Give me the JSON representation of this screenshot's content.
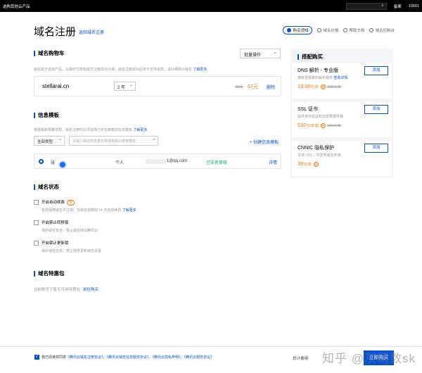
{
  "topbar": {
    "products": "选购其他云产品",
    "search_icon": "⌕",
    "lang": "备案",
    "account": "10001"
  },
  "header": {
    "title": "域名注册",
    "back_link": "返回域名注册",
    "links": [
      "购买须知",
      "域名价格",
      "帮助文档",
      "域名控制台"
    ]
  },
  "cart": {
    "title": "域名购物车",
    "desc": "域名属于虚拟产品，以最终付款和提交注册成功为准，域名注册成功后将不支持退款，请仔细核对域名",
    "desc_link": "了解更多",
    "batch_label": "批量操作",
    "item": {
      "domain": "stellarai.cn",
      "years": "2 年",
      "old_price": "78元",
      "price": "67元",
      "delete": "删除"
    }
  },
  "template": {
    "title": "信息模板",
    "desc": "根据最新政策法规，域名注册时必须选择已实名审核的信息模板",
    "desc_link": "了解更多",
    "filter_type": "全部类型",
    "search_placeholder": "请输入域名所有者名称或模板ID搜索模板",
    "create_link": "创建信息模板",
    "row": {
      "name": "张",
      "type": "个人",
      "email": "1@qq.com",
      "status": "已实名审核",
      "detail": "详情"
    }
  },
  "status": {
    "title": "域名状态",
    "options": [
      {
        "label": "开启自动续费",
        "badge": "荐",
        "sub": "有效保障域名不过期，在域名到期前 14 天自动续费",
        "sub_link": "了解更多"
      },
      {
        "label": "开启禁止转移锁",
        "sub": "保护域名安全，禁止域名转出腾讯云"
      },
      {
        "label": "开启禁止更新锁",
        "sub": "保护域名信息，禁止随意更新域名设置"
      }
    ]
  },
  "coupon": {
    "title": "域名特惠包",
    "text": "当前账号下暂无可用特惠包",
    "link": "前往购买"
  },
  "side": {
    "title": "搭配购买",
    "add_label": "添加",
    "cards": [
      {
        "name": "DNS 解析 - 专业版",
        "desc": "拥有更极致的解析服务",
        "desc_link": "查看详情",
        "price": "19.90",
        "unit": "元/年",
        "old": "168元/年"
      },
      {
        "name": "SSL 证书",
        "desc": "提供身份验证和加密数据传输",
        "price": "532",
        "unit": "元/年 起",
        "old": "580元/年"
      },
      {
        "name": "CNNIC 隐私保护",
        "desc": "支持 .CN 、中国类域名开通。",
        "price": "39",
        "unit": "元/年",
        "old": ""
      }
    ]
  },
  "footer": {
    "agree_prefix": "我已阅读并同意",
    "agreements": [
      "《腾讯云域名注册协议》",
      "《腾讯云域名信息服务协议》",
      "《腾讯云隐私声明》",
      "《腾讯云服务协议》"
    ],
    "total_label": "总计费用",
    "amount": "",
    "buy_label": "立即购买"
  },
  "watermark": "知乎 @灰萌数sk"
}
